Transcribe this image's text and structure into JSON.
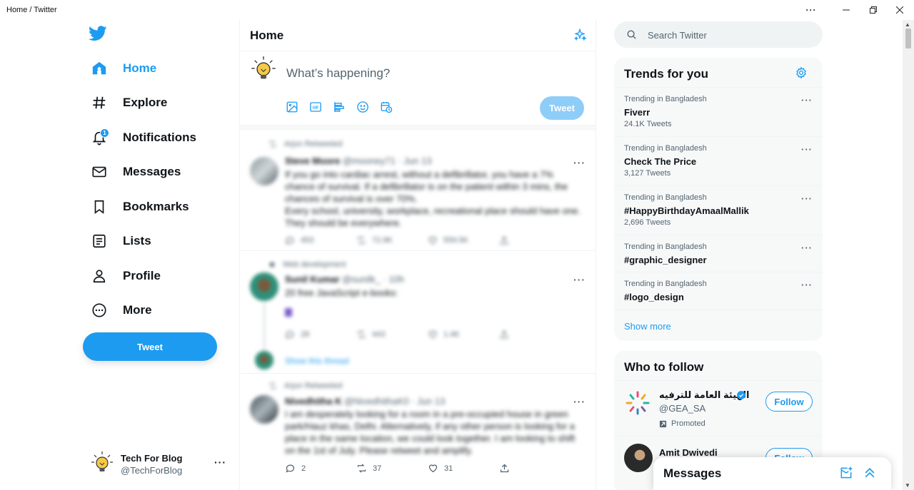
{
  "window": {
    "title": "Home / Twitter",
    "controls": [
      "more",
      "minimize",
      "restore",
      "close"
    ]
  },
  "nav": {
    "logo": "twitter-bird-icon",
    "items": [
      {
        "label": "Home",
        "icon": "home-icon",
        "active": true
      },
      {
        "label": "Explore",
        "icon": "hashtag-icon"
      },
      {
        "label": "Notifications",
        "icon": "bell-icon",
        "badge": "1"
      },
      {
        "label": "Messages",
        "icon": "envelope-icon"
      },
      {
        "label": "Bookmarks",
        "icon": "bookmark-icon"
      },
      {
        "label": "Lists",
        "icon": "list-icon"
      },
      {
        "label": "Profile",
        "icon": "person-icon"
      },
      {
        "label": "More",
        "icon": "more-circle-icon"
      }
    ],
    "tweet_button": "Tweet",
    "account": {
      "name": "Tech For Blog",
      "handle": "@TechForBlog",
      "more": "···"
    }
  },
  "center": {
    "title": "Home",
    "composer": {
      "placeholder": "What’s happening?",
      "tweet_button": "Tweet"
    },
    "posts": [
      {
        "context": "Arjun Retweeted",
        "name": "Steve Moore",
        "meta": "@mooney71 · Jun 13",
        "text": "If you go into cardiac arrest, without a defibrillator, you have a 7% chance of survival. If a defibrillator is on the patient within 3 mins, the chances of survival is over 70%.",
        "text2": "Every school, university, workplace, recreational place should have one. They should be everywhere.",
        "actions": [
          "453",
          "72.9K",
          "559.5K",
          ""
        ]
      },
      {
        "context": "Web development",
        "name": "Sunil Kumar",
        "meta": "@sunilk_ · 10h",
        "text": "20 free JavaScript e-books:",
        "actions": [
          "28",
          "443",
          "1.4K",
          ""
        ],
        "thread_link": "Show this thread"
      },
      {
        "context": "Arjun Retweeted",
        "name": "Nivedhitha K",
        "meta": "@NivedhithaK0 · Jun 13",
        "text": "I am desperately looking for a room in a pre-occupied house in green park/Hauz khas, Delhi. Alternatively, if any other person is looking for a place in the same location, we could look together. I am looking to shift on the 1st of July. Please retweet and amplify.",
        "actions": [
          "2",
          "37",
          "31",
          ""
        ]
      }
    ]
  },
  "right": {
    "search_placeholder": "Search Twitter",
    "trends_title": "Trends for you",
    "trends": [
      {
        "meta": "Trending in Bangladesh",
        "name": "Fiverr",
        "count": "24.1K Tweets"
      },
      {
        "meta": "Trending in Bangladesh",
        "name": "Check The Price",
        "count": "3,127 Tweets"
      },
      {
        "meta": "Trending in Bangladesh",
        "name": "#HappyBirthdayAmaalMallik",
        "count": "2,696 Tweets"
      },
      {
        "meta": "Trending in Bangladesh",
        "name": "#graphic_designer",
        "count": ""
      },
      {
        "meta": "Trending in Bangladesh",
        "name": "#logo_design",
        "count": ""
      }
    ],
    "show_more": "Show more",
    "who_title": "Who to follow",
    "who": [
      {
        "name": "الهيئة العامة للترفيه",
        "handle": "@GEA_SA",
        "promoted": "Promoted",
        "button": "Follow"
      },
      {
        "name": "Amit Dwivedi",
        "handle": "",
        "button": "Follow"
      }
    ]
  },
  "messages_drawer": {
    "title": "Messages"
  },
  "colors": {
    "accent": "#1d9bf0",
    "tweet_disabled": "#8ecdf8",
    "muted": "#536471",
    "panel": "#f7f9f9"
  }
}
